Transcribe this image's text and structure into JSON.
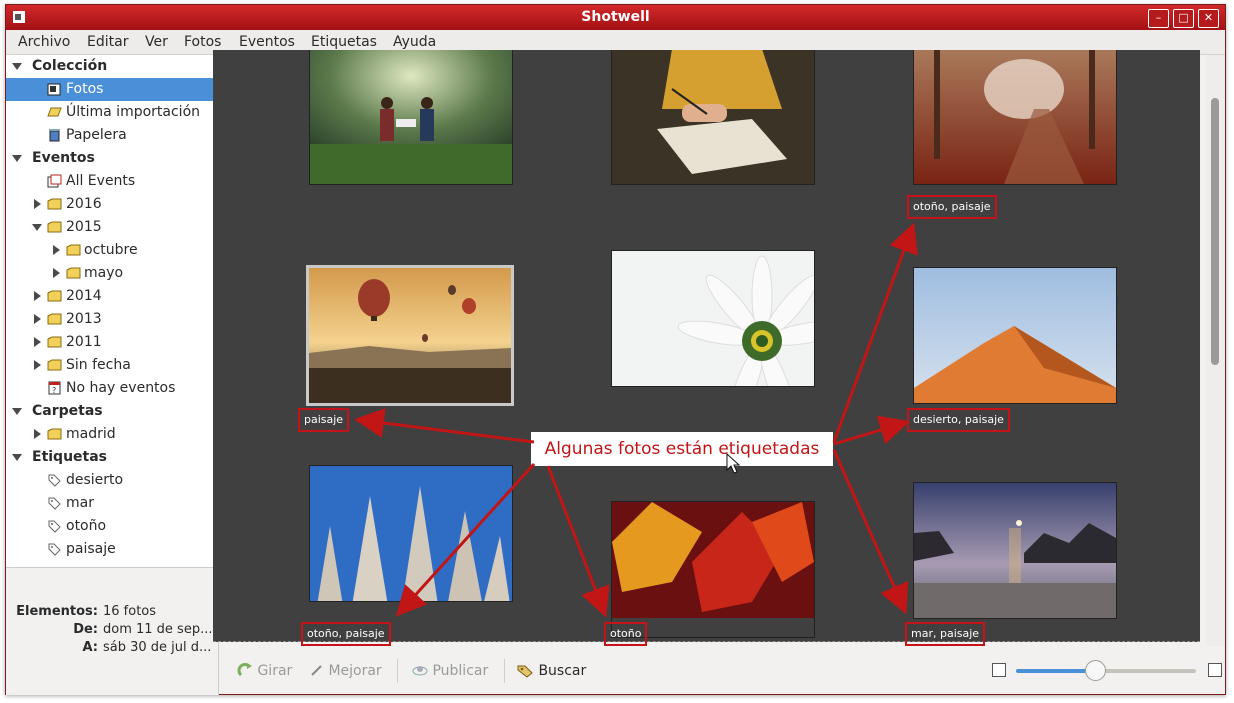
{
  "window": {
    "title": "Shotwell"
  },
  "menu": [
    "Archivo",
    "Editar",
    "Ver",
    "Fotos",
    "Eventos",
    "Etiquetas",
    "Ayuda"
  ],
  "sidebar": {
    "collection_header": "Colección",
    "photos": "Fotos",
    "last_import": "Última importación",
    "trash": "Papelera",
    "events_header": "Eventos",
    "all_events": "All Events",
    "y2016": "2016",
    "y2015": "2015",
    "october": "octubre",
    "may": "mayo",
    "y2014": "2014",
    "y2013": "2013",
    "y2011": "2011",
    "no_date": "Sin fecha",
    "no_events": "No hay eventos",
    "folders_header": "Carpetas",
    "madrid": "madrid",
    "tags_header": "Etiquetas",
    "tags": [
      "desierto",
      "mar",
      "otoño",
      "paisaje"
    ]
  },
  "info": {
    "elements_label": "Elementos:",
    "elements_value": "16 fotos",
    "from_label": "De:",
    "from_value": "dom 11 de sep...",
    "to_label": "A:",
    "to_value": "sáb 30 de jul d..."
  },
  "photos": [
    {
      "scene": "children-reading-forest",
      "tag": ""
    },
    {
      "scene": "person-writing-book",
      "tag": ""
    },
    {
      "scene": "autumn-path",
      "tag": "otoño, paisaje"
    },
    {
      "scene": "hot-air-balloons",
      "tag": "paisaje"
    },
    {
      "scene": "daisy",
      "tag": ""
    },
    {
      "scene": "desert-dune",
      "tag": "desierto, paisaje"
    },
    {
      "scene": "poplar-trees",
      "tag": "otoño, paisaje"
    },
    {
      "scene": "autumn-leaves",
      "tag": "otoño"
    },
    {
      "scene": "sea-rocks-moon",
      "tag": "mar, paisaje"
    }
  ],
  "annotation": {
    "text": "Algunas fotos están etiquetadas",
    "color": "#c21515"
  },
  "toolbar": {
    "rotate": "Girar",
    "enhance": "Mejorar",
    "publish": "Publicar",
    "find": "Buscar",
    "zoom_fraction": 0.44
  },
  "colors": {
    "selection": "#4a90d9",
    "titlebar": "#b51a1c",
    "content_bg": "#404040",
    "tag_border": "#c4141a"
  }
}
